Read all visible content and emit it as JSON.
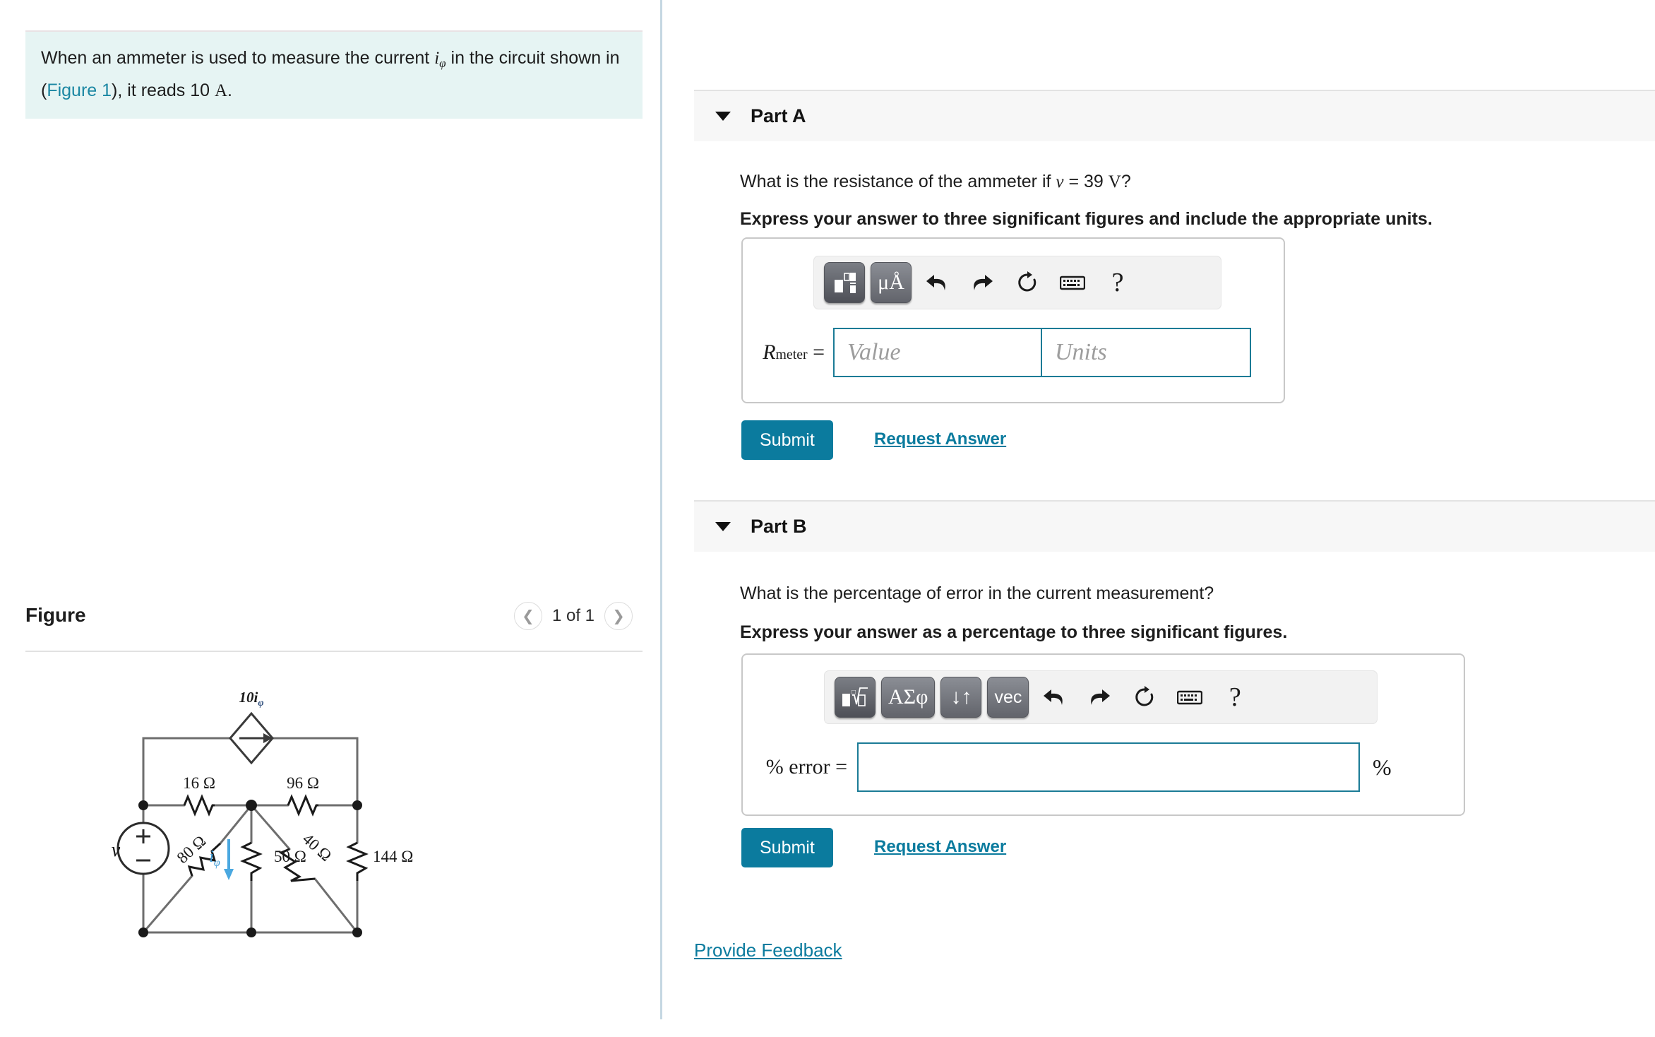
{
  "question": {
    "text_before": "When an ammeter is used to measure the current ",
    "symbol_i": "i",
    "symbol_i_sub": "φ",
    "text_mid": " in the circuit shown in (",
    "figure_link": "Figure 1",
    "text_after": "), it reads 10 ",
    "unit_A": "A",
    "period": "."
  },
  "figure": {
    "title": "Figure",
    "prev_icon": "chevron-left-icon",
    "next_icon": "chevron-right-icon",
    "counter": "1 of 1"
  },
  "circuit": {
    "source_label": "v",
    "source_plus": "+",
    "source_minus": "−",
    "dependent_source_label": "10i",
    "dependent_source_sub": "φ",
    "current_label": "i",
    "current_label_sub": "φ",
    "resistors": [
      {
        "name": "r-16",
        "label": "16 Ω"
      },
      {
        "name": "r-96",
        "label": "96 Ω"
      },
      {
        "name": "r-80",
        "label": "80 Ω"
      },
      {
        "name": "r-50",
        "label": "50 Ω"
      },
      {
        "name": "r-40",
        "label": "40 Ω"
      },
      {
        "name": "r-144",
        "label": "144 Ω"
      }
    ],
    "wire_color": "#6e6e6e",
    "current_arrow_color": "#4aa8e0"
  },
  "part_a": {
    "caret_icon": "caret-down-icon",
    "label": "Part A",
    "prompt_before": "What is the resistance of the ammeter if ",
    "prompt_var": "v",
    "prompt_eq": " = 39 ",
    "prompt_unit": "V",
    "prompt_qmark": "?",
    "instruction": "Express your answer to three significant figures and include the appropriate units.",
    "toolbar": [
      {
        "name": "template-button",
        "kind": "icon-template",
        "label": ""
      },
      {
        "name": "units-button",
        "kind": "text",
        "label": "μÅ"
      },
      {
        "name": "undo-icon",
        "kind": "undo",
        "label": ""
      },
      {
        "name": "redo-icon",
        "kind": "redo",
        "label": ""
      },
      {
        "name": "reset-icon",
        "kind": "reset",
        "label": ""
      },
      {
        "name": "keyboard-icon",
        "kind": "keyboard",
        "label": ""
      },
      {
        "name": "help-icon",
        "kind": "help",
        "label": "?"
      }
    ],
    "answer_label_main": "R",
    "answer_label_sub": "meter",
    "answer_label_eq": " =",
    "value_placeholder": "Value",
    "units_placeholder": "Units",
    "value_text": "",
    "units_text": "",
    "submit_label": "Submit",
    "request_label": "Request Answer"
  },
  "part_b": {
    "caret_icon": "caret-down-icon",
    "label": "Part B",
    "prompt": "What is the percentage of error in the current measurement?",
    "instruction": "Express your answer as a percentage to three significant figures.",
    "toolbar": [
      {
        "name": "template-root-button",
        "kind": "icon-root",
        "label": ""
      },
      {
        "name": "greek-button",
        "kind": "text",
        "label": "ΑΣφ"
      },
      {
        "name": "arrows-button",
        "kind": "text",
        "label": "↓↑"
      },
      {
        "name": "vector-button",
        "kind": "text-sans",
        "label": "vec"
      },
      {
        "name": "undo-icon",
        "kind": "undo",
        "label": ""
      },
      {
        "name": "redo-icon",
        "kind": "redo",
        "label": ""
      },
      {
        "name": "reset-icon",
        "kind": "reset",
        "label": ""
      },
      {
        "name": "keyboard-icon",
        "kind": "keyboard",
        "label": ""
      },
      {
        "name": "help-icon",
        "kind": "help",
        "label": "?"
      }
    ],
    "answer_label": "% error =",
    "answer_value": "",
    "suffix": "%",
    "submit_label": "Submit",
    "request_label": "Request Answer"
  },
  "footer": {
    "feedback_label": "Provide Feedback"
  },
  "colors": {
    "accent": "#0b7b9e",
    "question_bg": "#e6f4f3",
    "band_bg": "#f7f7f7",
    "input_border": "#1b7b96"
  }
}
